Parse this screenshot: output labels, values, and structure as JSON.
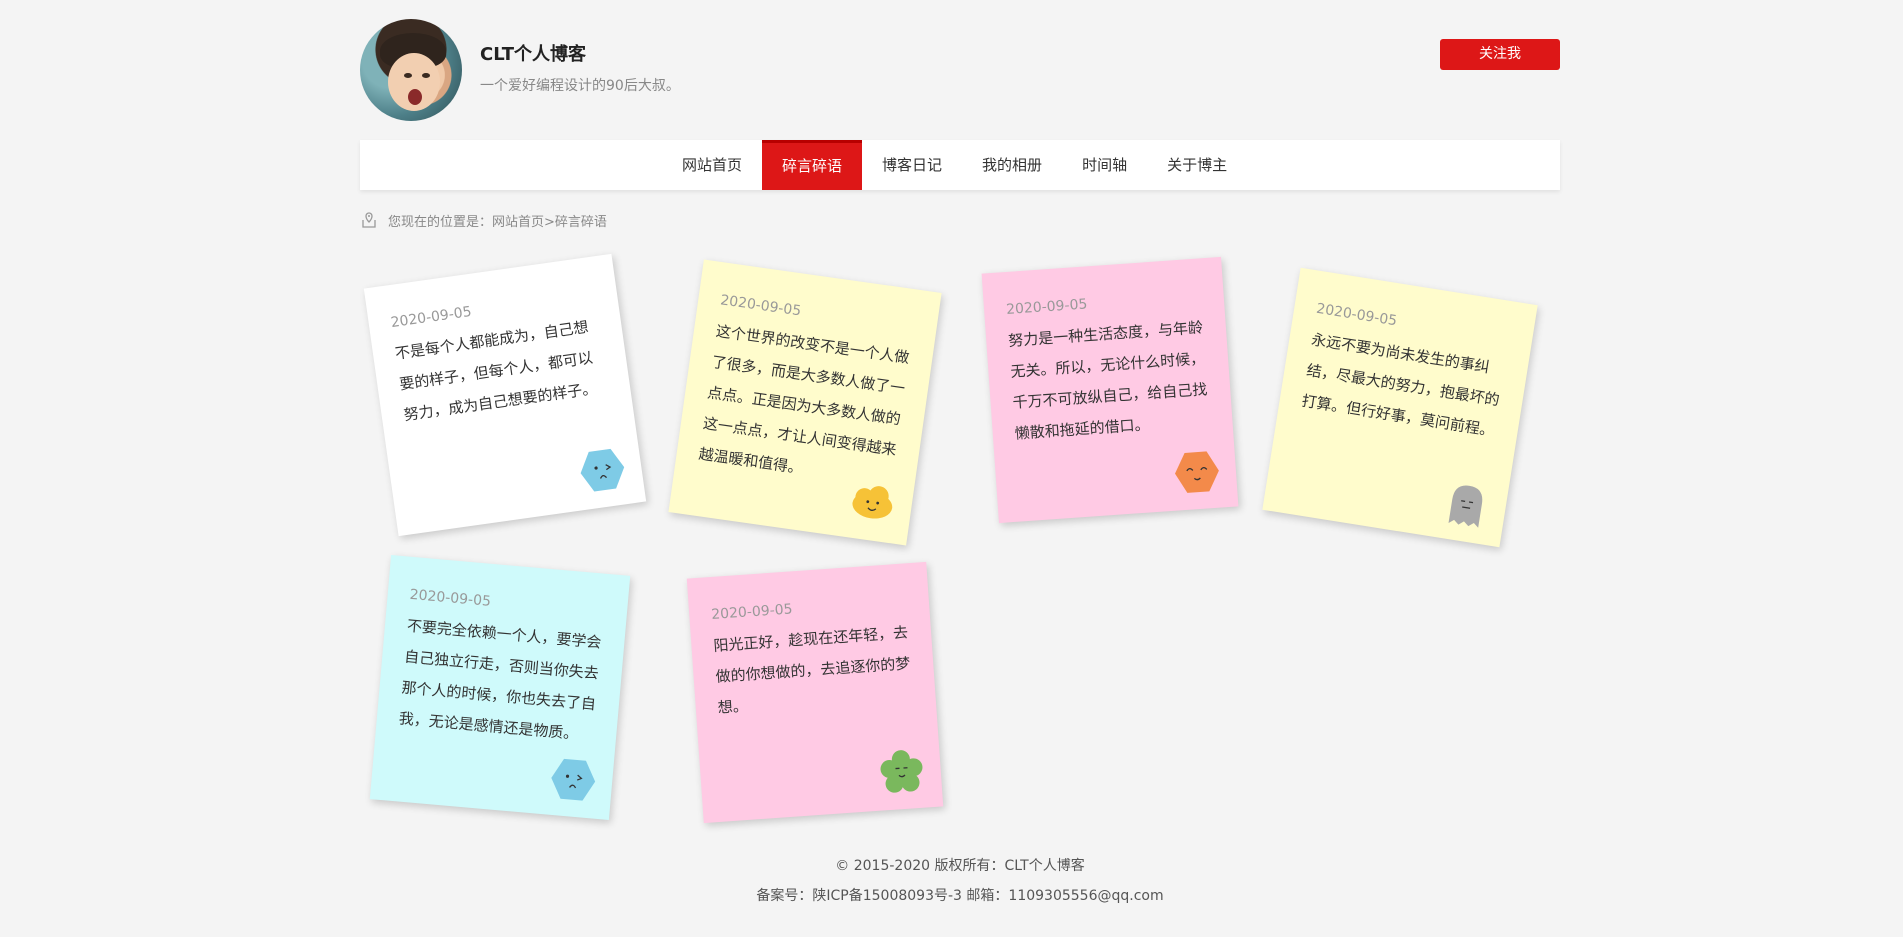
{
  "header": {
    "title": "CLT个人博客",
    "subtitle": "一个爱好编程设计的90后大叔。",
    "follow_label": "关注我"
  },
  "nav": {
    "items": [
      "网站首页",
      "碎言碎语",
      "博客日记",
      "我的相册",
      "时间轴",
      "关于博主"
    ],
    "active_index": 1
  },
  "breadcrumb": {
    "prefix": "您现在的位置是：",
    "path": "网站首页>碎言碎语"
  },
  "notes": [
    {
      "date": "2020-09-05",
      "text": "不是每个人都能成为，自己想要的样子，但每个人，都可以努力，成为自己想要的样子。",
      "color": "#ffffff",
      "icon": "hexagon-sad-blue-icon"
    },
    {
      "date": "2020-09-05",
      "text": "这个世界的改变不是一个人做了很多，而是大多数人做了一点点。正是因为大多数人做的这一点点，才让人间变得越来越温暖和值得。",
      "color": "#fffccc",
      "icon": "cloud-smile-yellow-icon"
    },
    {
      "date": "2020-09-05",
      "text": "努力是一种生活态度，与年龄无关。所以，无论什么时候，千万不可放纵自己，给自己找懒散和拖延的借口。",
      "color": "#ffcae4",
      "icon": "hexagon-happy-orange-icon"
    },
    {
      "date": "2020-09-05",
      "text": "永远不要为尚未发生的事纠结，尽最大的努力，抱最坏的打算。但行好事，莫问前程。",
      "color": "#fffccc",
      "icon": "ghost-gray-icon"
    },
    {
      "date": "2020-09-05",
      "text": "不要完全依赖一个人，要学会自己独立行走，否则当你失去那个人的时候，你也失去了自我，无论是感情还是物质。",
      "color": "#cffafb",
      "icon": "hexagon-sad-blue-icon"
    },
    {
      "date": "2020-09-05",
      "text": "阳光正好，趁现在还年轻，去做的你想做的，去追逐你的梦想。",
      "color": "#ffcae4",
      "icon": "flower-green-icon"
    }
  ],
  "footer": {
    "copyright": "© 2015-2020 版权所有：CLT个人博客",
    "icp": "备案号：陕ICP备15008093号-3",
    "email": "邮箱：1109305556@qq.com"
  },
  "colors": {
    "accent": "#dd1717",
    "background": "#f4f4f4"
  }
}
